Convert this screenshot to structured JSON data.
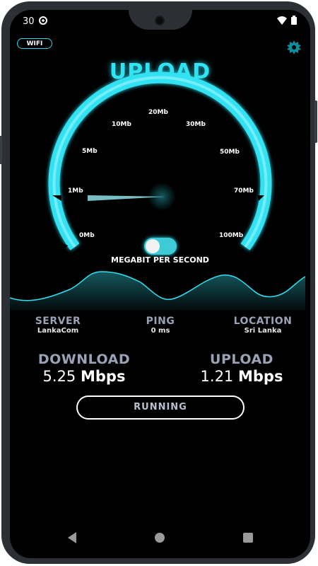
{
  "status_bar": {
    "time": "30",
    "icons": [
      "data-saver-icon",
      "wifi-icon",
      "battery-icon"
    ]
  },
  "header": {
    "wifi_badge": "WIFI",
    "settings_icon": "gear-icon",
    "title": "UPLOAD"
  },
  "gauge": {
    "labels": [
      "0Mb",
      "1Mb",
      "5Mb",
      "10Mb",
      "20Mb",
      "30Mb",
      "50Mb",
      "70Mb",
      "100Mb"
    ],
    "unit": "MEGABIT PER SECOND",
    "toggle_on": true,
    "accent": "#31e2f2"
  },
  "info": {
    "server_label": "SERVER",
    "server_value": "LankaCom",
    "ping_label": "PING",
    "ping_value": "0 ms",
    "location_label": "LOCATION",
    "location_value": "Sri Lanka"
  },
  "results": {
    "download_label": "DOWNLOAD",
    "download_value": "5.25",
    "download_unit": "Mbps",
    "upload_label": "UPLOAD",
    "upload_value": "1.21",
    "upload_unit": "Mbps"
  },
  "action": {
    "running_label": "RUNNING"
  },
  "colors": {
    "accent": "#31e2f2",
    "background": "#000000",
    "label": "#9aa3b5"
  }
}
